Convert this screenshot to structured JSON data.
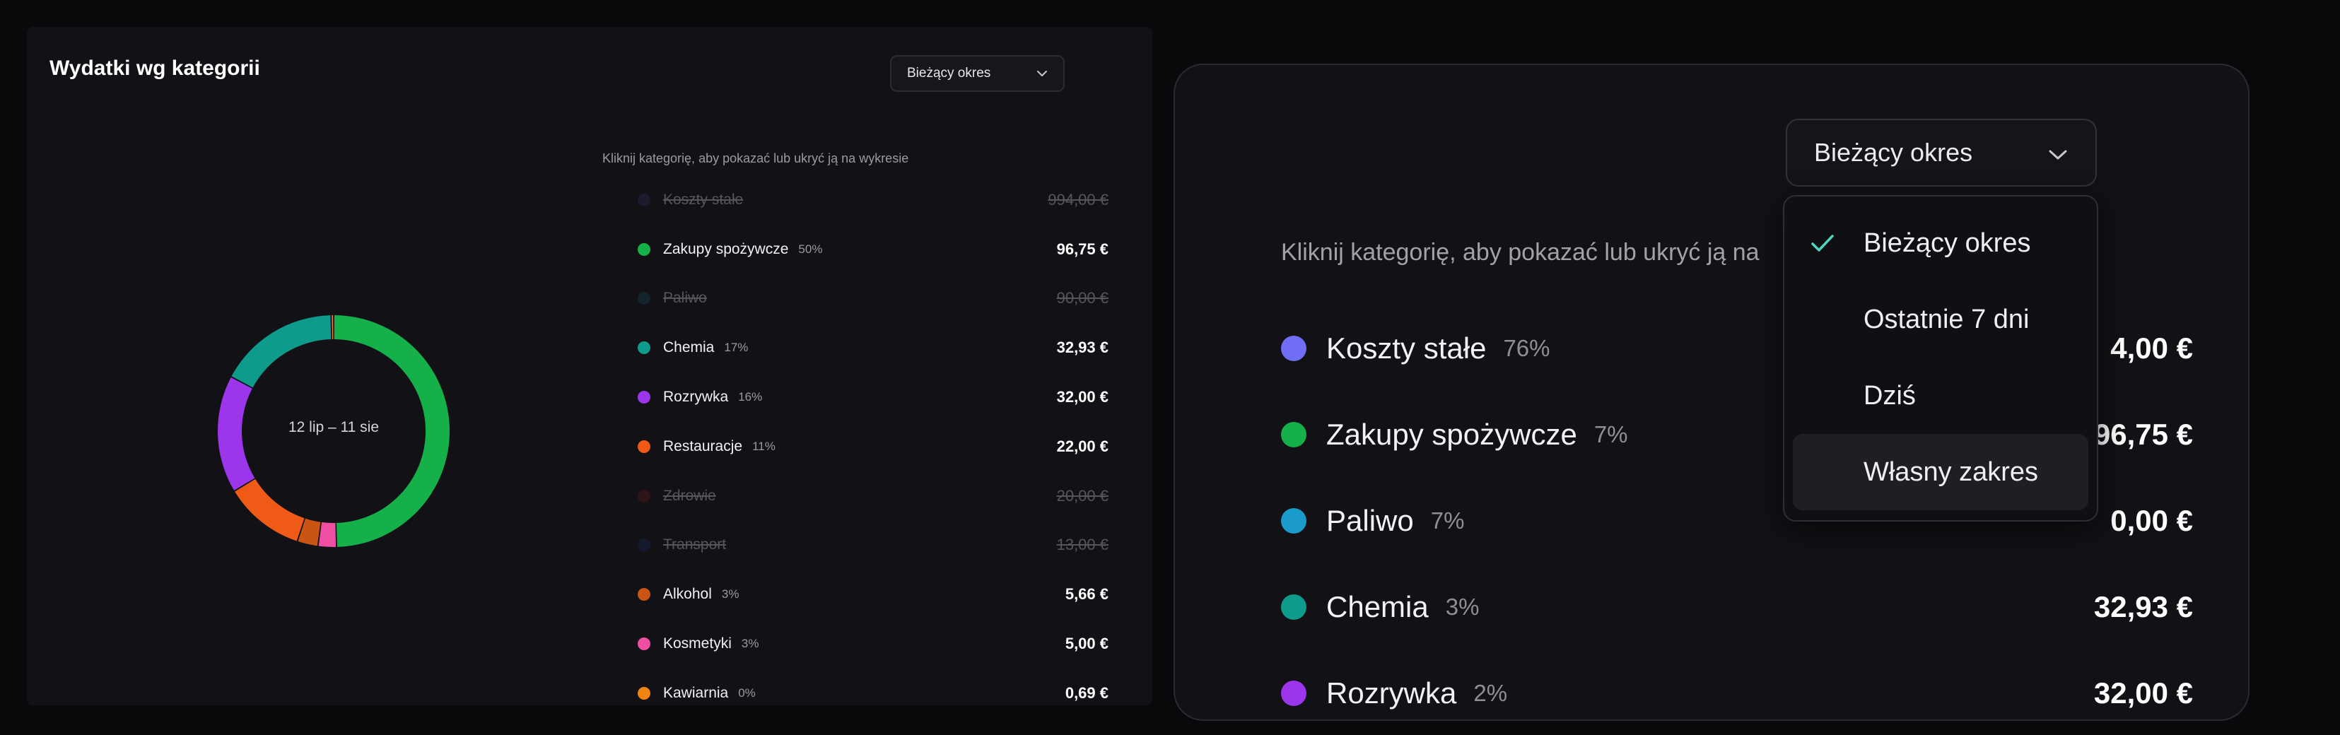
{
  "left": {
    "title": "Wydatki wg kategorii",
    "period_select": "Bieżący okres",
    "hint": "Kliknij kategorię, aby pokazać lub ukryć ją na wykresie",
    "date_range": "12 lip – 11 sie",
    "categories": [
      {
        "name": "Koszty stałe",
        "pct": "",
        "amount": "994,00 €",
        "hidden": true,
        "color": "#1b1b2e"
      },
      {
        "name": "Zakupy spożywcze",
        "pct": "50%",
        "amount": "96,75 €",
        "hidden": false,
        "color": "#16b04a"
      },
      {
        "name": "Paliwo",
        "pct": "",
        "amount": "90,00 €",
        "hidden": true,
        "color": "#13242c"
      },
      {
        "name": "Chemia",
        "pct": "17%",
        "amount": "32,93 €",
        "hidden": false,
        "color": "#0f9b8c"
      },
      {
        "name": "Rozrywka",
        "pct": "16%",
        "amount": "32,00 €",
        "hidden": false,
        "color": "#9b36ea"
      },
      {
        "name": "Restauracje",
        "pct": "11%",
        "amount": "22,00 €",
        "hidden": false,
        "color": "#f05a17"
      },
      {
        "name": "Zdrowie",
        "pct": "",
        "amount": "20,00 €",
        "hidden": true,
        "color": "#2c1418"
      },
      {
        "name": "Transport",
        "pct": "",
        "amount": "13,00 €",
        "hidden": true,
        "color": "#14192c"
      },
      {
        "name": "Alkohol",
        "pct": "3%",
        "amount": "5,66 €",
        "hidden": false,
        "color": "#c95515"
      },
      {
        "name": "Kosmetyki",
        "pct": "3%",
        "amount": "5,00 €",
        "hidden": false,
        "color": "#ee4fa3"
      },
      {
        "name": "Kawiarnia",
        "pct": "0%",
        "amount": "0,69 €",
        "hidden": false,
        "color": "#f08412"
      }
    ]
  },
  "chart_data": {
    "type": "pie",
    "variant": "donut",
    "center_label": "12 lip – 11 sie",
    "slices": [
      {
        "label": "Zakupy spożywcze",
        "value": 96.75,
        "color": "#16b04a"
      },
      {
        "label": "Kosmetyki",
        "value": 5.0,
        "color": "#ee4fa3"
      },
      {
        "label": "Alkohol",
        "value": 5.66,
        "color": "#c95515"
      },
      {
        "label": "Restauracje",
        "value": 22.0,
        "color": "#f05a17"
      },
      {
        "label": "Rozrywka",
        "value": 32.0,
        "color": "#9b36ea"
      },
      {
        "label": "Chemia",
        "value": 32.93,
        "color": "#0f9b8c"
      },
      {
        "label": "Kawiarnia",
        "value": 0.69,
        "color": "#f08412"
      }
    ]
  },
  "right": {
    "period_select": "Bieżący okres",
    "hint": "Kliknij kategorię, aby pokazać lub ukryć ją na",
    "categories": [
      {
        "name": "Koszty stałe",
        "pct": "76%",
        "amount": "4,00 €",
        "color": "#6f6ef5"
      },
      {
        "name": "Zakupy spożywcze",
        "pct": "7%",
        "amount": "96,75 €",
        "color": "#16b04a"
      },
      {
        "name": "Paliwo",
        "pct": "7%",
        "amount": "0,00 €",
        "color": "#1a9bc9"
      },
      {
        "name": "Chemia",
        "pct": "3%",
        "amount": "32,93 €",
        "color": "#0f9b8c"
      },
      {
        "name": "Rozrywka",
        "pct": "2%",
        "amount": "32,00 €",
        "color": "#9b36ea"
      }
    ],
    "dropdown": {
      "options": [
        {
          "label": "Bieżący okres",
          "selected": true,
          "hover": false
        },
        {
          "label": "Ostatnie 7 dni",
          "selected": false,
          "hover": false
        },
        {
          "label": "Dziś",
          "selected": false,
          "hover": false
        },
        {
          "label": "Własny zakres",
          "selected": false,
          "hover": true
        }
      ],
      "check_color": "#4fd6c0"
    }
  },
  "icons": {
    "select_chevron": "chevron-down-icon",
    "selected_option": "checkmark-icon"
  }
}
